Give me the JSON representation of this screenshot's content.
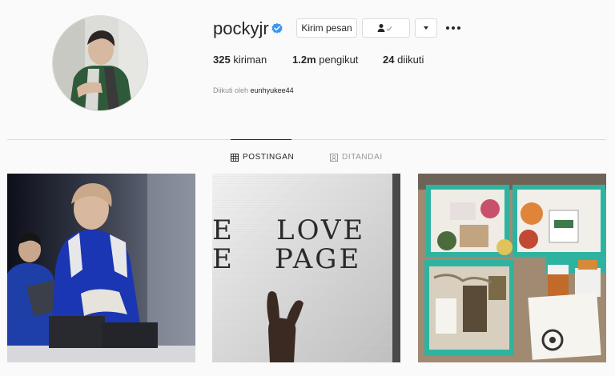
{
  "profile": {
    "username": "pockyjr",
    "verified": true,
    "message_button_label": "Kirim pesan",
    "stats": {
      "posts_count": "325",
      "posts_label": "kiriman",
      "followers_count": "1.2m",
      "followers_label": "pengikut",
      "following_count": "24",
      "following_label": "diikuti"
    },
    "followed_by_prefix": "Diikuti oleh",
    "followed_by_user": "eunhyukee44"
  },
  "tabs": [
    {
      "label": "POSTINGAN",
      "icon": "grid-icon",
      "active": true
    },
    {
      "label": "DITANDAI",
      "icon": "tag-icon",
      "active": false
    }
  ],
  "posts": [
    {
      "description": "concert-photo"
    },
    {
      "text_lines": [
        "LOVE",
        "PAGE"
      ],
      "side_text": [
        "E",
        "E"
      ]
    },
    {
      "description": "gift-boxes"
    }
  ],
  "colors": {
    "verified_blue": "#3897f0",
    "border": "#dbdbdb",
    "text": "#262626",
    "muted": "#8e8e8e"
  }
}
